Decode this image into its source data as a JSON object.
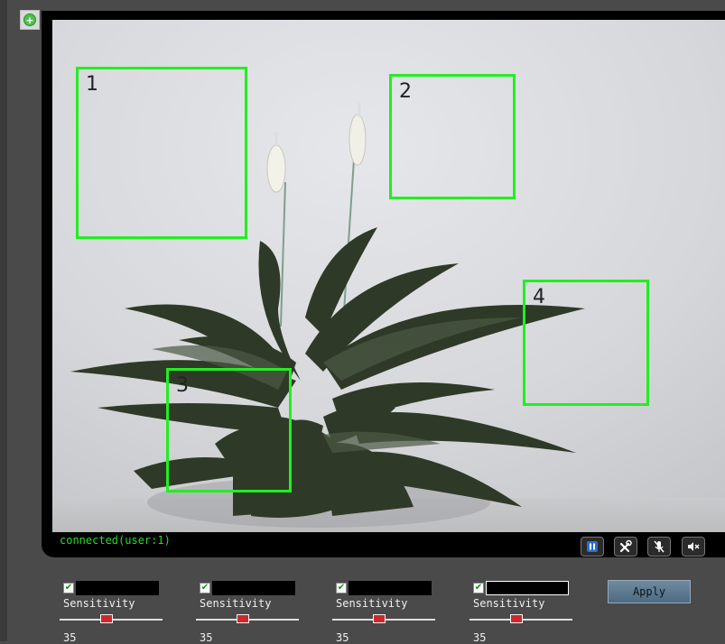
{
  "toolbar": {
    "add_icon": "plus-circle-icon"
  },
  "video": {
    "status": "connected(user:1)",
    "zones": [
      {
        "label": "1"
      },
      {
        "label": "2"
      },
      {
        "label": "3"
      },
      {
        "label": "4"
      }
    ],
    "zone_color": "#22ee22",
    "status_color": "#2bd92b"
  },
  "controls": {
    "buttons": [
      {
        "name": "pause",
        "icon": "pause-icon"
      },
      {
        "name": "settings",
        "icon": "tools-icon"
      },
      {
        "name": "mic",
        "icon": "mic-muted-icon"
      },
      {
        "name": "speaker",
        "icon": "speaker-muted-icon"
      }
    ]
  },
  "detection_zones": [
    {
      "checked": "✔",
      "sensitivity_label": "Sensitivity",
      "sensitivity": 35,
      "value_text": "35",
      "slider_fraction": 0.46
    },
    {
      "checked": "✔",
      "sensitivity_label": "Sensitivity",
      "sensitivity": 35,
      "value_text": "35",
      "slider_fraction": 0.46
    },
    {
      "checked": "✔",
      "sensitivity_label": "Sensitivity",
      "sensitivity": 35,
      "value_text": "35",
      "slider_fraction": 0.46
    },
    {
      "checked": "✔",
      "sensitivity_label": "Sensitivity",
      "sensitivity": 35,
      "value_text": "35",
      "slider_fraction": 0.46
    }
  ],
  "apply_label": "Apply",
  "colors": {
    "accent": "#22ee22",
    "slider_thumb": "#cc2a2a",
    "apply_button": "#5a7890"
  }
}
